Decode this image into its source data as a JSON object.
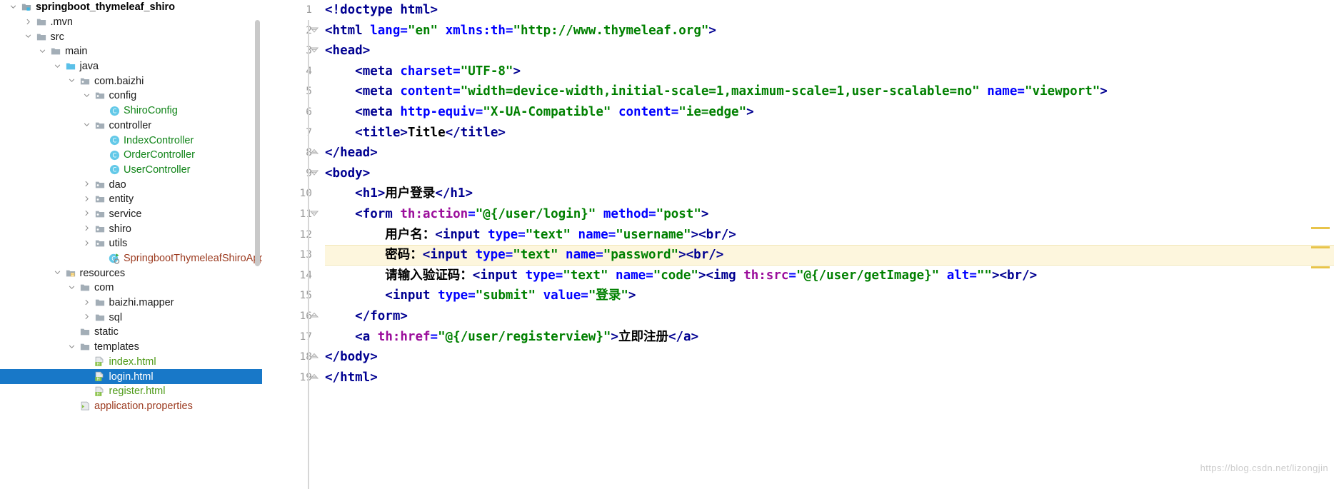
{
  "app": {
    "ide": "IntelliJ IDEA",
    "open_file": "login.html"
  },
  "project_tree": {
    "name": "Project tool window",
    "nodes": [
      {
        "label": "springboot_thymeleaf_shiro",
        "depth": 0,
        "twisty": "expanded",
        "icon": "module-folder-icon",
        "style": "bold",
        "selected": false
      },
      {
        "label": ".mvn",
        "depth": 1,
        "twisty": "collapsed",
        "icon": "folder-icon",
        "style": "plain",
        "selected": false
      },
      {
        "label": "src",
        "depth": 1,
        "twisty": "expanded",
        "icon": "folder-icon",
        "style": "plain",
        "selected": false
      },
      {
        "label": "main",
        "depth": 2,
        "twisty": "expanded",
        "icon": "folder-icon",
        "style": "plain",
        "selected": false
      },
      {
        "label": "java",
        "depth": 3,
        "twisty": "expanded",
        "icon": "source-folder-icon",
        "style": "plain",
        "selected": false
      },
      {
        "label": "com.baizhi",
        "depth": 4,
        "twisty": "expanded",
        "icon": "package-icon",
        "style": "plain",
        "selected": false
      },
      {
        "label": "config",
        "depth": 5,
        "twisty": "expanded",
        "icon": "package-icon",
        "style": "plain",
        "selected": false
      },
      {
        "label": "ShiroConfig",
        "depth": 6,
        "twisty": "none",
        "icon": "java-class-icon",
        "style": "class",
        "selected": false
      },
      {
        "label": "controller",
        "depth": 5,
        "twisty": "expanded",
        "icon": "package-icon",
        "style": "plain",
        "selected": false
      },
      {
        "label": "IndexController",
        "depth": 6,
        "twisty": "none",
        "icon": "java-class-icon",
        "style": "class",
        "selected": false
      },
      {
        "label": "OrderController",
        "depth": 6,
        "twisty": "none",
        "icon": "java-class-icon",
        "style": "class",
        "selected": false
      },
      {
        "label": "UserController",
        "depth": 6,
        "twisty": "none",
        "icon": "java-class-icon",
        "style": "class",
        "selected": false
      },
      {
        "label": "dao",
        "depth": 5,
        "twisty": "collapsed",
        "icon": "package-icon",
        "style": "plain",
        "selected": false
      },
      {
        "label": "entity",
        "depth": 5,
        "twisty": "collapsed",
        "icon": "package-icon",
        "style": "plain",
        "selected": false
      },
      {
        "label": "service",
        "depth": 5,
        "twisty": "collapsed",
        "icon": "package-icon",
        "style": "plain",
        "selected": false
      },
      {
        "label": "shiro",
        "depth": 5,
        "twisty": "collapsed",
        "icon": "package-icon",
        "style": "plain",
        "selected": false
      },
      {
        "label": "utils",
        "depth": 5,
        "twisty": "collapsed",
        "icon": "package-icon",
        "style": "plain",
        "selected": false
      },
      {
        "label": "SpringbootThymeleafShiroApplication",
        "depth": 6,
        "twisty": "none",
        "icon": "spring-boot-class-icon",
        "style": "brown",
        "selected": false
      },
      {
        "label": "resources",
        "depth": 3,
        "twisty": "expanded",
        "icon": "resources-folder-icon",
        "style": "plain",
        "selected": false
      },
      {
        "label": "com",
        "depth": 4,
        "twisty": "expanded",
        "icon": "folder-icon",
        "style": "plain",
        "selected": false
      },
      {
        "label": "baizhi.mapper",
        "depth": 5,
        "twisty": "collapsed",
        "icon": "folder-icon",
        "style": "plain",
        "selected": false
      },
      {
        "label": "sql",
        "depth": 5,
        "twisty": "collapsed",
        "icon": "folder-icon",
        "style": "plain",
        "selected": false
      },
      {
        "label": "static",
        "depth": 4,
        "twisty": "none",
        "icon": "folder-icon",
        "style": "plain",
        "selected": false
      },
      {
        "label": "templates",
        "depth": 4,
        "twisty": "expanded",
        "icon": "folder-icon",
        "style": "plain",
        "selected": false
      },
      {
        "label": "index.html",
        "depth": 5,
        "twisty": "none",
        "icon": "html-file-icon",
        "style": "htmlgreen",
        "selected": false
      },
      {
        "label": "login.html",
        "depth": 5,
        "twisty": "none",
        "icon": "html-file-icon",
        "style": "htmlgreen",
        "selected": true
      },
      {
        "label": "register.html",
        "depth": 5,
        "twisty": "none",
        "icon": "html-file-icon",
        "style": "htmlgreen",
        "selected": false
      },
      {
        "label": "application.properties",
        "depth": 4,
        "twisty": "none",
        "icon": "properties-file-icon",
        "style": "brown",
        "selected": false
      }
    ]
  },
  "editor": {
    "name": "code-editor",
    "line_numbers": [
      "1",
      "2",
      "3",
      "4",
      "5",
      "6",
      "7",
      "8",
      "9",
      "10",
      "11",
      "12",
      "13",
      "14",
      "15",
      "16",
      "17",
      "18",
      "19"
    ],
    "highlighted_line": 13,
    "lines": [
      {
        "n": 1,
        "text": "<!doctype html>"
      },
      {
        "n": 2,
        "text": "<html lang=\"en\" xmlns:th=\"http://www.thymeleaf.org\">"
      },
      {
        "n": 3,
        "text": "<head>"
      },
      {
        "n": 4,
        "text": "    <meta charset=\"UTF-8\">"
      },
      {
        "n": 5,
        "text": "    <meta content=\"width=device-width,initial-scale=1,maximum-scale=1,user-scalable=no\" name=\"viewport\">"
      },
      {
        "n": 6,
        "text": "    <meta http-equiv=\"X-UA-Compatible\" content=\"ie=edge\">"
      },
      {
        "n": 7,
        "text": "    <title>Title</title>"
      },
      {
        "n": 8,
        "text": "</head>"
      },
      {
        "n": 9,
        "text": "<body>"
      },
      {
        "n": 10,
        "text": "    <h1>用户登录</h1>"
      },
      {
        "n": 11,
        "text": "    <form th:action=\"@{/user/login}\" method=\"post\">"
      },
      {
        "n": 12,
        "text": "        用户名：<input type=\"text\" name=\"username\"><br/>"
      },
      {
        "n": 13,
        "text": "        密码：<input type=\"text\" name=\"password\"><br/>"
      },
      {
        "n": 14,
        "text": "        请输入验证码：<input type=\"text\" name=\"code\"><img th:src=\"@{/user/getImage}\" alt=\"\"><br/>"
      },
      {
        "n": 15,
        "text": "        <input type=\"submit\" value=\"登录\">"
      },
      {
        "n": 16,
        "text": "    </form>"
      },
      {
        "n": 17,
        "text": "    <a th:href=\"@{/user/registerview}\">立即注册</a>"
      },
      {
        "n": 18,
        "text": "</body>"
      },
      {
        "n": 19,
        "text": "</html>"
      }
    ],
    "fold_lines": [
      2,
      3,
      8,
      9,
      11,
      16,
      18,
      19
    ]
  },
  "watermark": {
    "text": "https://blog.csdn.net/lizongjin"
  },
  "colors": {
    "selection_blue": "#1878c8",
    "tag_blue": "#000091",
    "attr_blue": "#0000ff",
    "th_attr_purple": "#9b0d9b",
    "string_green": "#008000",
    "highlight_line": "#fdf6dd",
    "class_green": "#12851a",
    "boot_brown": "#9c3b20",
    "stripe_yellow": "#e8c44a"
  }
}
